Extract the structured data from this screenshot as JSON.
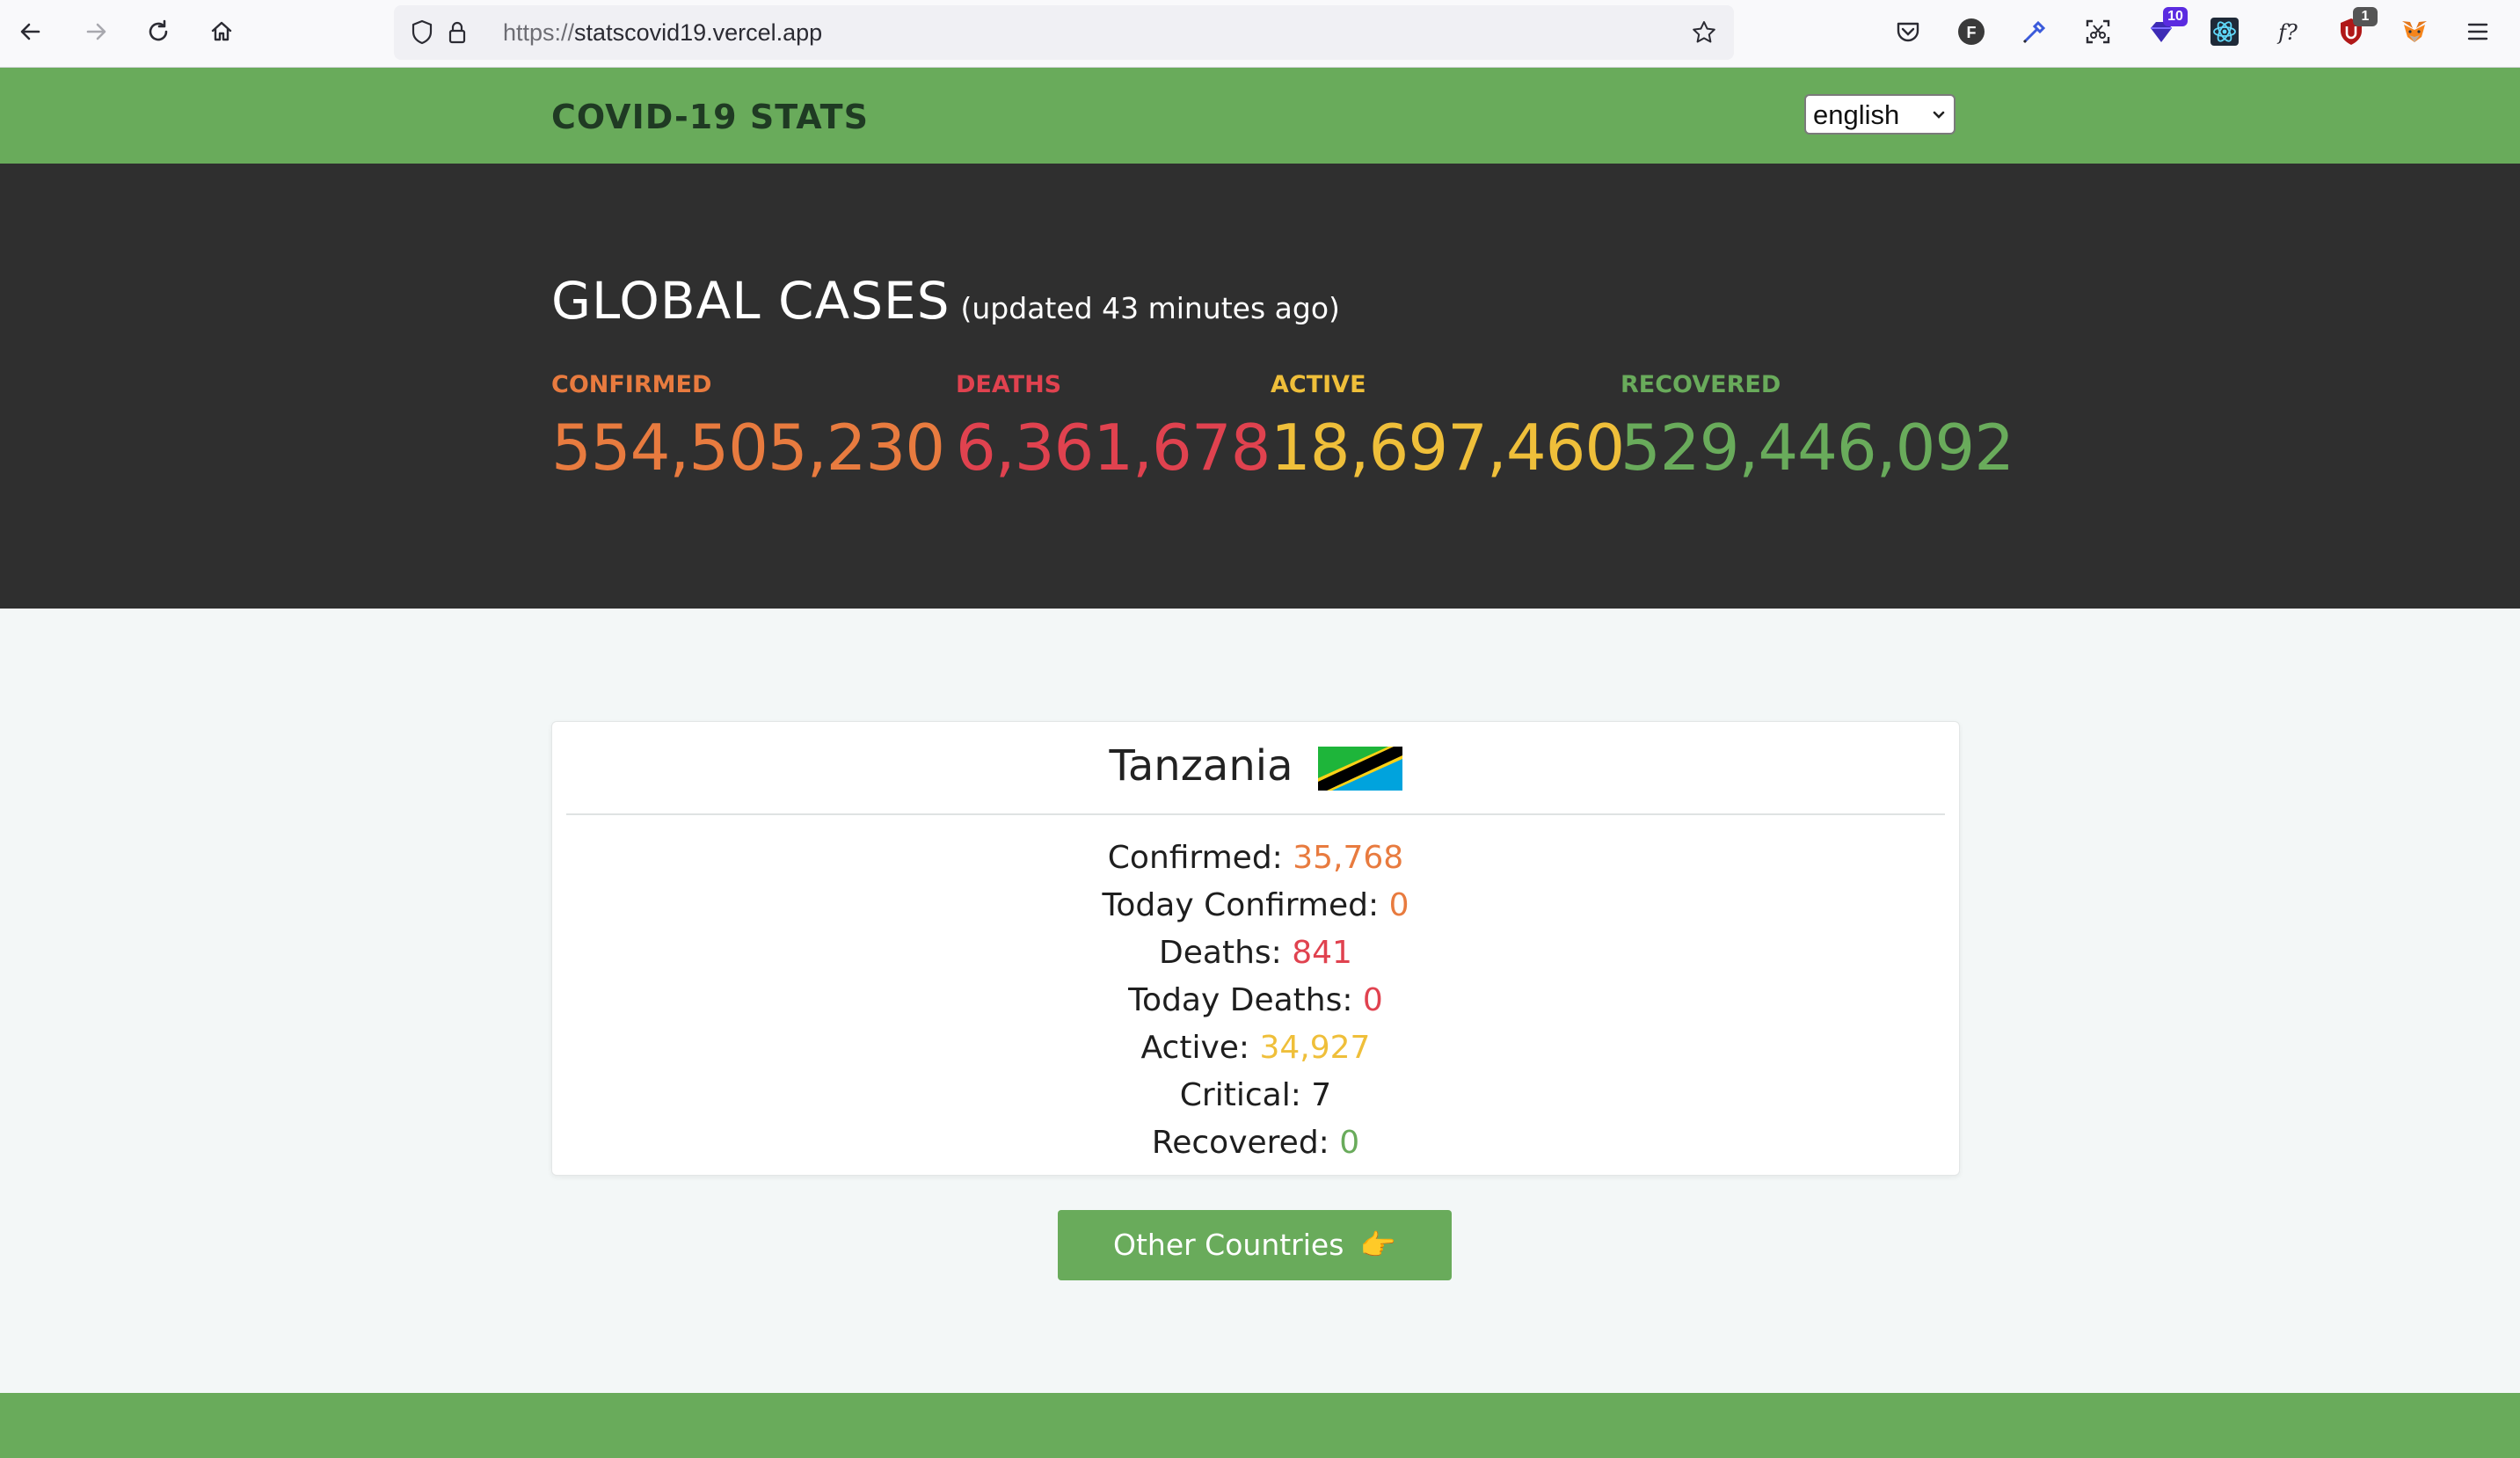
{
  "browser": {
    "url_protocol": "https://",
    "url_host": "statscovid19.vercel.app",
    "extensions": [
      {
        "icon": "pocket-icon"
      },
      {
        "icon": "f-extension-icon",
        "letter": "F"
      },
      {
        "icon": "eyedropper-icon"
      },
      {
        "icon": "screenshot-icon"
      },
      {
        "icon": "gem-extension-icon",
        "badge": "10"
      },
      {
        "icon": "react-devtools-icon"
      },
      {
        "icon": "font-finder-icon",
        "label": "f?"
      },
      {
        "icon": "ublock-icon",
        "badge": "1"
      },
      {
        "icon": "metamask-icon"
      },
      {
        "icon": "menu-icon"
      }
    ]
  },
  "header": {
    "brand": "COVID-19 STATS",
    "language": {
      "selected": "english",
      "options": [
        "english"
      ]
    }
  },
  "global": {
    "title": "GLOBAL CASES",
    "updated": "(updated 43 minutes ago)",
    "stats": [
      {
        "label": "CONFIRMED",
        "value": "554,505,230",
        "color": "#e87b3f"
      },
      {
        "label": "DEATHS",
        "value": "6,361,678",
        "color": "#e0424f"
      },
      {
        "label": "ACTIVE",
        "value": "18,697,460",
        "color": "#efbf3a"
      },
      {
        "label": "RECOVERED",
        "value": "529,446,092",
        "color": "#69ab5b"
      }
    ]
  },
  "country": {
    "name": "Tanzania",
    "rows": [
      {
        "label": "Confirmed: ",
        "value": "35,768",
        "color": "#e87b3f"
      },
      {
        "label": "Today Confirmed: ",
        "value": "0",
        "color": "#e87b3f"
      },
      {
        "label": "Deaths: ",
        "value": "841",
        "color": "#e0424f"
      },
      {
        "label": "Today Deaths: ",
        "value": "0",
        "color": "#e0424f"
      },
      {
        "label": "Active: ",
        "value": "34,927",
        "color": "#efbf3a"
      },
      {
        "label": "Critical: ",
        "value": "7",
        "color": "#1e1e1e"
      },
      {
        "label": "Recovered: ",
        "value": "0",
        "color": "#69ab5b"
      }
    ]
  },
  "other_countries_button": {
    "label": "Other Countries ",
    "hand": "👉"
  }
}
